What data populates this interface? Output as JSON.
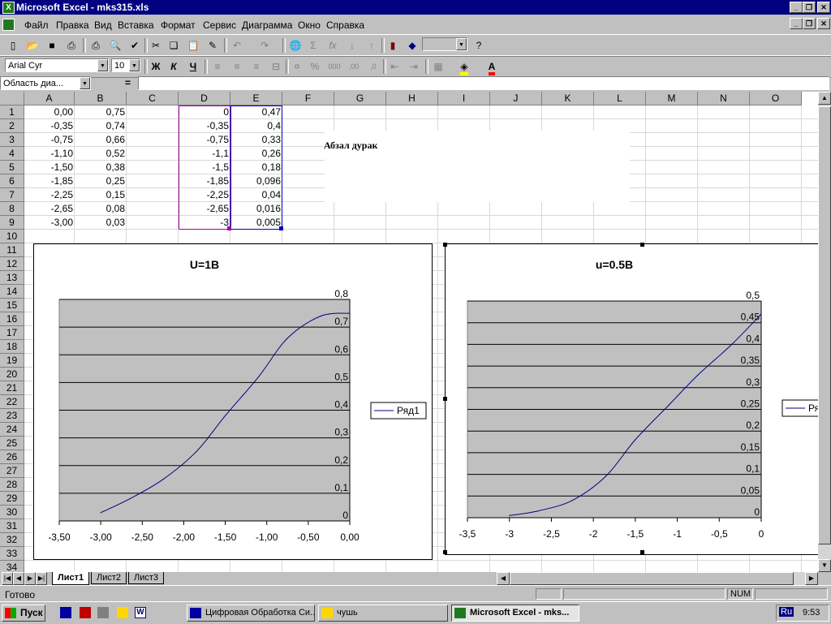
{
  "window": {
    "title": "Microsoft Excel - mks315.xls",
    "app_icon_letter": "X"
  },
  "menu": [
    "Файл",
    "Правка",
    "Вид",
    "Вставка",
    "Формат",
    "Сервис",
    "Диаграмма",
    "Окно",
    "Справка"
  ],
  "format_toolbar": {
    "font": "Arial Cyr",
    "size": "10",
    "bold": "Ж",
    "italic": "К",
    "underline": "Ч",
    "percent": "%",
    "thousands": "000",
    "inc_decimal": ",00",
    "dec_decimal": ",0"
  },
  "formula_bar": {
    "name_box": "Область диа...",
    "equals": "=",
    "value": ""
  },
  "columns": [
    "A",
    "B",
    "C",
    "D",
    "E",
    "F",
    "G",
    "H",
    "I",
    "J",
    "K",
    "L",
    "M",
    "N",
    "O"
  ],
  "rows": [
    "1",
    "2",
    "3",
    "4",
    "5",
    "6",
    "7",
    "8",
    "9",
    "10",
    "11",
    "12",
    "13",
    "14",
    "15",
    "16",
    "17",
    "18",
    "19",
    "20",
    "21",
    "22",
    "23",
    "24",
    "25",
    "26",
    "27",
    "28",
    "29",
    "30",
    "31",
    "32",
    "33",
    "34"
  ],
  "cells": {
    "A": [
      "0,00",
      "-0,35",
      "-0,75",
      "-1,10",
      "-1,50",
      "-1,85",
      "-2,25",
      "-2,65",
      "-3,00"
    ],
    "B": [
      "0,75",
      "0,74",
      "0,66",
      "0,52",
      "0,38",
      "0,25",
      "0,15",
      "0,08",
      "0,03"
    ],
    "D": [
      "0",
      "-0,35",
      "-0,75",
      "-1,1",
      "-1,5",
      "-1,85",
      "-2,25",
      "-2,65",
      "-3"
    ],
    "E": [
      "0,47",
      "0,4",
      "0,33",
      "0,26",
      "0,18",
      "0,096",
      "0,04",
      "0,016",
      "0,005"
    ],
    "G3": "Абзал дурак"
  },
  "chart_data": [
    {
      "type": "line",
      "title": "U=1B",
      "series": [
        {
          "name": "Ряд1",
          "x": [
            -3.0,
            -2.65,
            -2.25,
            -1.85,
            -1.5,
            -1.1,
            -0.75,
            -0.35,
            0.0
          ],
          "y": [
            0.03,
            0.08,
            0.15,
            0.25,
            0.38,
            0.52,
            0.66,
            0.74,
            0.75
          ]
        }
      ],
      "xlim": [
        -3.5,
        0.0
      ],
      "ylim": [
        0,
        0.8
      ],
      "x_ticks": [
        "-3,50",
        "-3,00",
        "-2,50",
        "-2,00",
        "-1,50",
        "-1,00",
        "-0,50",
        "0,00"
      ],
      "y_ticks": [
        "0",
        "0,1",
        "0,2",
        "0,3",
        "0,4",
        "0,5",
        "0,6",
        "0,7",
        "0,8"
      ],
      "plot_background": "#c0c0c0",
      "line_color": "#000080",
      "grid": "horizontal",
      "legend": "right"
    },
    {
      "type": "line",
      "title": "u=0.5B",
      "series": [
        {
          "name": "Ря",
          "x": [
            -3.0,
            -2.65,
            -2.25,
            -1.85,
            -1.5,
            -1.1,
            -0.75,
            -0.35,
            0.0
          ],
          "y": [
            0.005,
            0.016,
            0.04,
            0.096,
            0.18,
            0.26,
            0.33,
            0.4,
            0.47
          ]
        }
      ],
      "xlim": [
        -3.5,
        0.0
      ],
      "ylim": [
        0,
        0.5
      ],
      "x_ticks": [
        "-3,5",
        "-3",
        "-2,5",
        "-2",
        "-1,5",
        "-1",
        "-0,5",
        "0"
      ],
      "y_ticks": [
        "0",
        "0,05",
        "0,1",
        "0,15",
        "0,2",
        "0,25",
        "0,3",
        "0,35",
        "0,4",
        "0,45",
        "0,5"
      ],
      "plot_background": "#c0c0c0",
      "line_color": "#000080",
      "grid": "horizontal",
      "legend": "right"
    }
  ],
  "sheet_tabs": [
    "Лист1",
    "Лист2",
    "Лист3"
  ],
  "status": {
    "text": "Готово",
    "num": "NUM"
  },
  "taskbar": {
    "start": "Пуск",
    "tasks": [
      "Цифровая Обработка Си...",
      "чушь",
      "Microsoft Excel - mks..."
    ],
    "lang": "Ru",
    "clock": "9:53"
  }
}
